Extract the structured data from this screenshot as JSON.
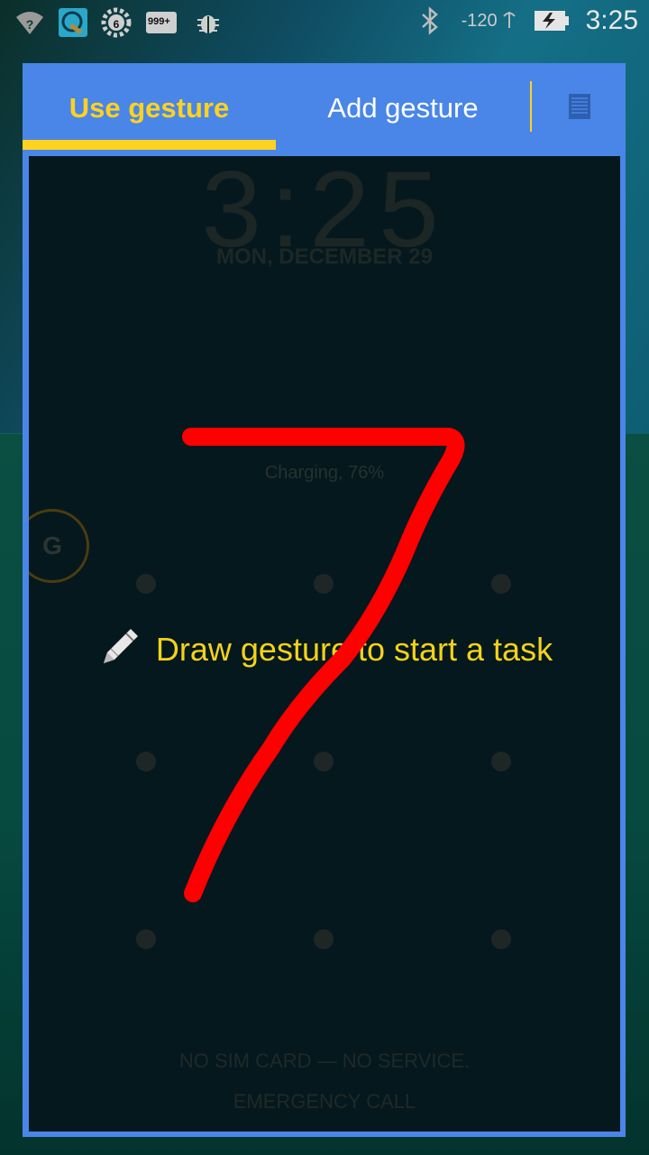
{
  "status_bar": {
    "time": "3:25",
    "signal_text": "-120",
    "icons": [
      "wifi-icon",
      "app-icon",
      "settings-badge-icon",
      "storage-icon",
      "bug-icon",
      "bluetooth-icon",
      "signal-icon",
      "battery-icon"
    ],
    "settings_badge": "6",
    "storage_badge": "999+"
  },
  "tabs": {
    "use_gesture": "Use gesture",
    "add_gesture": "Add gesture"
  },
  "lockscreen": {
    "time": "3:25",
    "date": "MON, DECEMBER 29",
    "charging": "Charging, 76%",
    "avatar_letter": "G",
    "no_sim": "NO SIM CARD — NO SERVICE.",
    "emergency": "EMERGENCY CALL"
  },
  "hint": {
    "text": "Draw gesture to start a task",
    "icon": "pencil-icon"
  },
  "colors": {
    "accent": "#ffd21f",
    "panel": "#4a86e8",
    "stroke": "#ff0000"
  }
}
